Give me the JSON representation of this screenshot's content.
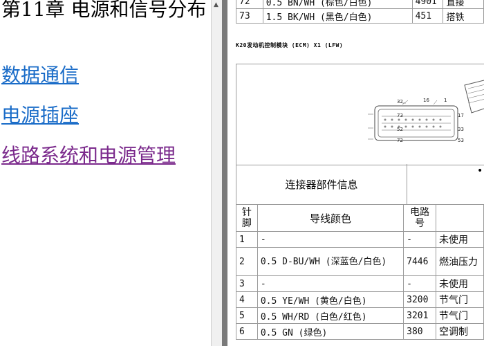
{
  "nav": {
    "chapter_title": "第11章 电源和信号分布",
    "links": [
      {
        "label": "数据通信",
        "color": "#1a6cc8"
      },
      {
        "label": "电源插座",
        "color": "#1a6cc8"
      },
      {
        "label": "线路系统和电源管理",
        "color": "#7b2a8c"
      }
    ]
  },
  "top_rows": [
    {
      "pin": "72",
      "wire": "0.5 BN/WH (棕色/白色)",
      "circuit": "4901",
      "func": "直接"
    },
    {
      "pin": "73",
      "wire": "1.5 BK/WH (黑色/白色)",
      "circuit": "451",
      "func": "搭铁"
    }
  ],
  "section_title": "K20发动机控制模块 (ECM) X1 (LFW)",
  "connector_labels": [
    "32",
    "16",
    "1",
    "73",
    "52",
    "72"
  ],
  "connector_labels_right": [
    "17",
    "33",
    "53"
  ],
  "info_row": {
    "label": "连接器部件信息",
    "bullet": "•"
  },
  "table": {
    "headers": {
      "pin": "针脚",
      "wire": "导线颜色",
      "circuit": "电路号"
    },
    "rows": [
      {
        "pin": "1",
        "wire": "-",
        "circuit": "-",
        "func": "未使用"
      },
      {
        "pin": "2",
        "wire": "0.5 D-BU/WH (深蓝色/白色)",
        "circuit": "7446",
        "func": "燃油压力"
      },
      {
        "pin": "3",
        "wire": "-",
        "circuit": "-",
        "func": "未使用"
      },
      {
        "pin": "4",
        "wire": "0.5 YE/WH (黄色/白色)",
        "circuit": "3200",
        "func": "节气门"
      },
      {
        "pin": "5",
        "wire": "0.5 WH/RD (白色/红色)",
        "circuit": "3201",
        "func": "节气门"
      },
      {
        "pin": "6",
        "wire": "0.5 GN (绿色)",
        "circuit": "380",
        "func": "空调制"
      }
    ]
  }
}
